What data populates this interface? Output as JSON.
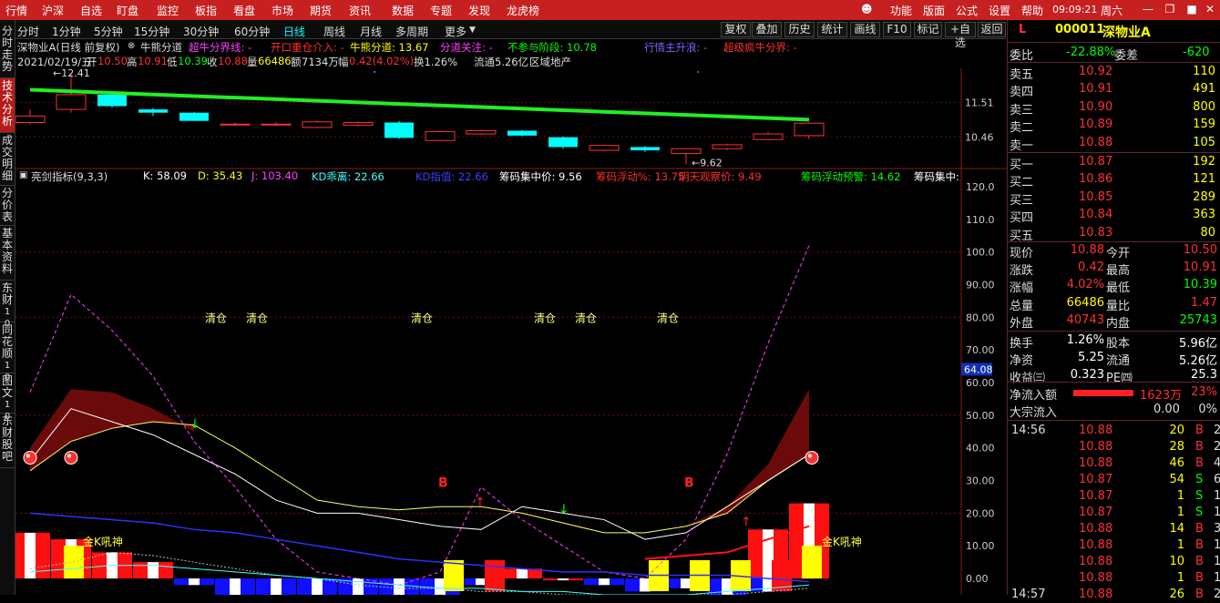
{
  "menu": {
    "items": [
      "行情",
      "沪深",
      "自选",
      "盯盘",
      "监控",
      "板指",
      "看盘",
      "市场",
      "期货",
      "资讯",
      "数据",
      "专题",
      "发现",
      "龙虎榜"
    ],
    "right": [
      "功能",
      "版面",
      "公式",
      "设置",
      "帮助"
    ],
    "time": "09:09:21",
    "weekday": "周六"
  },
  "left_tabs": [
    "分时走势",
    "技术分析",
    "成交明细",
    "分价表",
    "基本资料",
    "东财10",
    "同花顺10",
    "图文10",
    "东财股吧"
  ],
  "period_tabs": [
    "分时",
    "1分钟",
    "5分钟",
    "15分钟",
    "30分钟",
    "60分钟",
    "日线",
    "周线",
    "月线",
    "多周期",
    "更多"
  ],
  "selected_period": "日线",
  "right_buttons": [
    "复权",
    "叠加",
    "历史",
    "统计",
    "画线",
    "F10",
    "标记",
    "+自选",
    "返回"
  ],
  "info_line1": {
    "stock": "深物业A(日线 前复权)",
    "indicator": "牛熊分道",
    "items": [
      {
        "text": "超牛分界线: -",
        "color": "#ff40ff"
      },
      {
        "text": "开口重仓介入: -",
        "color": "#ff3030"
      },
      {
        "text": "牛熊分道: 13.67",
        "color": "#ffff00"
      },
      {
        "text": "分道关注: -",
        "color": "#ff40ff"
      },
      {
        "text": "不参与阶段: 10.78",
        "color": "#00ff00"
      },
      {
        "text": "行情主升浪: -",
        "color": "#8060ff"
      },
      {
        "text": "超级疯牛分界: -",
        "color": "#ff3030"
      }
    ]
  },
  "info_line2": {
    "date": "2021/02/19/五",
    "open_label": "开",
    "open": "10.50",
    "high_label": "高",
    "high": "10.91",
    "low_label": "低",
    "low": "10.39",
    "close_label": "收",
    "close": "10.88",
    "vol_label": "量",
    "vol": "66486",
    "amt_label": "额",
    "amt": "7134万",
    "amp_label": "幅",
    "amp": "0.42(4.02%)",
    "turnover": "换1.26%",
    "float": "流通5.26亿",
    "sector": "区域地产"
  },
  "info_line3": {
    "indicator": "亮剑指标(9,3,3)",
    "items": [
      {
        "text": "K: 58.09",
        "color": "#ffffff"
      },
      {
        "text": "D: 35.43",
        "color": "#ffff00"
      },
      {
        "text": "J: 103.40",
        "color": "#ff40ff"
      },
      {
        "text": "KD乖离: 22.66",
        "color": "#40ffff"
      },
      {
        "text": "KD指值: 22.66",
        "color": "#4040ff"
      },
      {
        "text": "筹码集中价: 9.56",
        "color": "#ffffff"
      },
      {
        "text": "筹码浮动%: 13.75",
        "color": "#ff3030"
      },
      {
        "text": "明天观察价: 9.49",
        "color": "#ff3030"
      },
      {
        "text": "筹码浮动预警: 14.62",
        "color": "#00ff00"
      },
      {
        "text": "筹码集中:",
        "color": "#ffffff"
      }
    ]
  },
  "price_axis": [
    "11.51",
    "10.46"
  ],
  "price_labels": {
    "high": "12.41",
    "low": "9.62"
  },
  "ind_axis": [
    "120.0",
    "110.0",
    "100.0",
    "90.00",
    "80.00",
    "70.00",
    "60.00",
    "50.00",
    "40.00",
    "30.00",
    "20.00",
    "10.00",
    "0.00"
  ],
  "ind_current": "64.08",
  "chart_text": {
    "qingcang": [
      "清仓",
      "清仓",
      "清仓",
      "清仓",
      "清仓",
      "清仓"
    ],
    "b_marks": [
      "B",
      "B"
    ],
    "jinkong": [
      "金K吼神",
      "金K吼神"
    ]
  },
  "candles": [
    {
      "o": 10.9,
      "c": 11.1,
      "h": 11.3,
      "l": 10.85
    },
    {
      "o": 11.3,
      "c": 11.75,
      "h": 12.41,
      "l": 11.2
    },
    {
      "o": 11.75,
      "c": 11.4,
      "h": 11.85,
      "l": 11.35
    },
    {
      "o": 11.3,
      "c": 11.2,
      "h": 11.35,
      "l": 11.1
    },
    {
      "o": 11.2,
      "c": 10.95,
      "h": 11.22,
      "l": 10.95
    },
    {
      "o": 10.85,
      "c": 10.85,
      "h": 10.9,
      "l": 10.8
    },
    {
      "o": 10.85,
      "c": 10.85,
      "h": 10.92,
      "l": 10.8
    },
    {
      "o": 10.75,
      "c": 10.92,
      "h": 10.96,
      "l": 10.73
    },
    {
      "o": 10.82,
      "c": 10.9,
      "h": 10.93,
      "l": 10.78
    },
    {
      "o": 10.9,
      "c": 10.43,
      "h": 10.95,
      "l": 10.4
    },
    {
      "o": 10.35,
      "c": 10.62,
      "h": 10.66,
      "l": 10.32
    },
    {
      "o": 10.55,
      "c": 10.65,
      "h": 10.68,
      "l": 10.52
    },
    {
      "o": 10.65,
      "c": 10.5,
      "h": 10.67,
      "l": 10.48
    },
    {
      "o": 10.45,
      "c": 10.15,
      "h": 10.48,
      "l": 10.1
    },
    {
      "o": 10.05,
      "c": 10.2,
      "h": 10.22,
      "l": 10.02
    },
    {
      "o": 10.15,
      "c": 10.05,
      "h": 10.18,
      "l": 10.0
    },
    {
      "o": 9.95,
      "c": 10.1,
      "h": 10.12,
      "l": 9.62
    },
    {
      "o": 10.1,
      "c": 10.22,
      "h": 10.25,
      "l": 10.05
    },
    {
      "o": 10.38,
      "c": 10.55,
      "h": 10.62,
      "l": 10.35
    },
    {
      "o": 10.5,
      "c": 10.88,
      "h": 10.91,
      "l": 10.39
    }
  ],
  "quote": {
    "code": "000011",
    "name": "深物业A",
    "flag": "L",
    "weibi_label": "委比",
    "weibi": "-22.88%",
    "weicha_label": "委差",
    "weicha": "-620",
    "asks": [
      {
        "label": "卖五",
        "price": "10.92",
        "vol": "110"
      },
      {
        "label": "卖四",
        "price": "10.91",
        "vol": "491"
      },
      {
        "label": "卖三",
        "price": "10.90",
        "vol": "800"
      },
      {
        "label": "卖二",
        "price": "10.89",
        "vol": "159"
      },
      {
        "label": "卖一",
        "price": "10.88",
        "vol": "105"
      }
    ],
    "bids": [
      {
        "label": "买一",
        "price": "10.87",
        "vol": "192"
      },
      {
        "label": "买二",
        "price": "10.86",
        "vol": "121"
      },
      {
        "label": "买三",
        "price": "10.85",
        "vol": "289"
      },
      {
        "label": "买四",
        "price": "10.84",
        "vol": "363"
      },
      {
        "label": "买五",
        "price": "10.83",
        "vol": "80"
      }
    ],
    "stats": [
      {
        "l1": "现价",
        "v1": "10.88",
        "c1": "#ff3030",
        "l2": "今开",
        "v2": "10.50",
        "c2": "#ff3030"
      },
      {
        "l1": "涨跌",
        "v1": "0.42",
        "c1": "#ff3030",
        "l2": "最高",
        "v2": "10.91",
        "c2": "#ff3030"
      },
      {
        "l1": "涨幅",
        "v1": "4.02%",
        "c1": "#ff3030",
        "l2": "最低",
        "v2": "10.39",
        "c2": "#00ff00"
      },
      {
        "l1": "总量",
        "v1": "66486",
        "c1": "#ffff00",
        "l2": "量比",
        "v2": "1.47",
        "c2": "#ff3030"
      },
      {
        "l1": "外盘",
        "v1": "40743",
        "c1": "#ff3030",
        "l2": "内盘",
        "v2": "25743",
        "c2": "#00ff00"
      },
      {
        "l1": "换手",
        "v1": "1.26%",
        "c1": "#ffffff",
        "l2": "股本",
        "v2": "5.96亿",
        "c2": "#ffffff"
      },
      {
        "l1": "净资",
        "v1": "5.25",
        "c1": "#ffffff",
        "l2": "流通",
        "v2": "5.26亿",
        "c2": "#ffffff"
      },
      {
        "l1": "收益㈢",
        "v1": "0.323",
        "c1": "#ffffff",
        "l2": "PE㈣",
        "v2": "25.3",
        "c2": "#ffffff"
      }
    ],
    "netflow_label": "净流入额",
    "netflow": "1623万",
    "netflow_pct": "23%",
    "bigflow_label": "大宗流入",
    "bigflow": "0.00",
    "bigflow_pct": "0%",
    "ticks": [
      {
        "time": "14:56",
        "price": "10.88",
        "vol": "20",
        "side": "B",
        "n": "2"
      },
      {
        "time": "",
        "price": "10.88",
        "vol": "28",
        "side": "B",
        "n": "2"
      },
      {
        "time": "",
        "price": "10.88",
        "vol": "46",
        "side": "B",
        "n": "4"
      },
      {
        "time": "",
        "price": "10.87",
        "vol": "54",
        "side": "S",
        "n": "6"
      },
      {
        "time": "",
        "price": "10.87",
        "vol": "1",
        "side": "S",
        "n": "1"
      },
      {
        "time": "",
        "price": "10.87",
        "vol": "1",
        "side": "S",
        "n": "1"
      },
      {
        "time": "",
        "price": "10.88",
        "vol": "14",
        "side": "B",
        "n": "3"
      },
      {
        "time": "",
        "price": "10.88",
        "vol": "1",
        "side": "B",
        "n": "1"
      },
      {
        "time": "",
        "price": "10.88",
        "vol": "10",
        "side": "B",
        "n": "1"
      },
      {
        "time": "",
        "price": "10.88",
        "vol": "1",
        "side": "B",
        "n": "1"
      },
      {
        "time": "14:57",
        "price": "10.88",
        "vol": "26",
        "side": "B",
        "n": "2"
      }
    ]
  },
  "colors": {
    "up": "#ff3030",
    "down": "#00ffff",
    "accent": "#c62020",
    "green": "#00ff00",
    "yellow": "#ffff00"
  }
}
